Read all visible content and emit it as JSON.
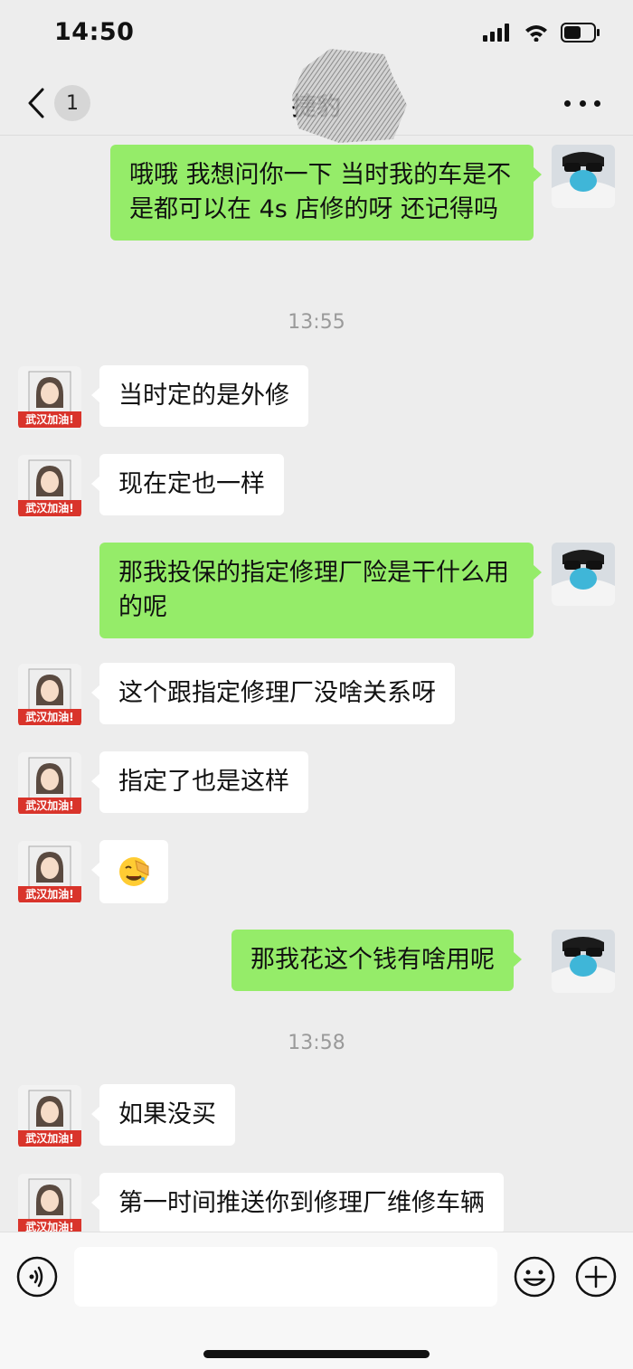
{
  "status_bar": {
    "time": "14:50"
  },
  "nav": {
    "back_count": "1",
    "title": "捷豹"
  },
  "timestamps": [
    "13:55",
    "13:58"
  ],
  "messages": [
    {
      "side": "out",
      "text": "哦哦 我想问你一下 当时我的车是不是都可以在 4s 店修的呀 还记得吗"
    },
    {
      "side": "in",
      "text": "当时定的是外修"
    },
    {
      "side": "in",
      "text": "现在定也一样"
    },
    {
      "side": "out",
      "text": "那我投保的指定修理厂险是干什么用的呢"
    },
    {
      "side": "in",
      "text": "这个跟指定修理厂没啥关系呀"
    },
    {
      "side": "in",
      "text": "指定了也是这样"
    },
    {
      "side": "in",
      "emoji": "🤦",
      "text": ""
    },
    {
      "side": "out",
      "text": "那我花这个钱有啥用呢"
    },
    {
      "side": "in",
      "text": "如果没买"
    },
    {
      "side": "in",
      "text": "第一时间推送你到修理厂维修车辆"
    }
  ],
  "avatar_badge_text": "武汉加油!",
  "input": {
    "value": "",
    "placeholder": ""
  },
  "icons": {
    "back": "chevron-left-icon",
    "more": "more-icon",
    "voice": "voice-icon",
    "emoji": "smiley-icon",
    "plus": "plus-icon"
  },
  "colors": {
    "bubble_out": "#95ec69",
    "bubble_in": "#ffffff",
    "background": "#ededed"
  }
}
